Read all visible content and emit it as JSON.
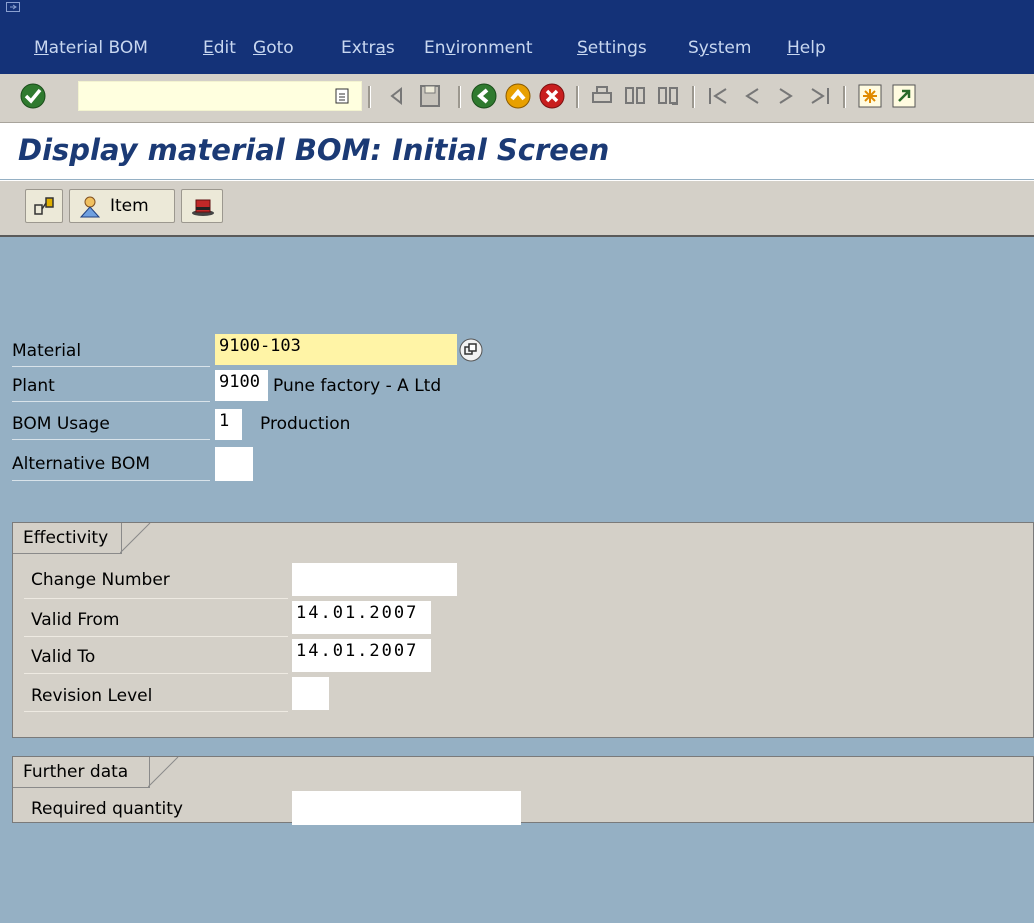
{
  "menu": {
    "items": [
      {
        "label": "Material BOM",
        "mnemonic_index": 0
      },
      {
        "label": "Edit",
        "mnemonic_index": 0
      },
      {
        "label": "Goto",
        "mnemonic_index": 0
      },
      {
        "label": "Extras",
        "mnemonic_index": 4
      },
      {
        "label": "Environment",
        "mnemonic_index": 2
      },
      {
        "label": "Settings",
        "mnemonic_index": 0
      },
      {
        "label": "System",
        "mnemonic_index": 1
      },
      {
        "label": "Help",
        "mnemonic_index": 0
      }
    ]
  },
  "toolbar": {
    "command_value": "",
    "icons": [
      "enter-icon",
      "back-arrow-icon",
      "save-icon",
      "back-icon",
      "exit-icon",
      "cancel-icon",
      "print-icon",
      "find-icon",
      "find-next-icon",
      "first-page-icon",
      "previous-page-icon",
      "next-page-icon",
      "last-page-icon",
      "new-session-icon",
      "shortcut-icon"
    ]
  },
  "page": {
    "title": "Display material BOM: Initial Screen"
  },
  "app_toolbar": {
    "item_label": "Item"
  },
  "form": {
    "material_label": "Material",
    "material_value": "9100-103",
    "plant_label": "Plant",
    "plant_value": "9100",
    "plant_desc": "Pune factory - A Ltd",
    "usage_label": "BOM Usage",
    "usage_value": "1",
    "usage_desc": "Production",
    "alt_bom_label": "Alternative BOM",
    "alt_bom_value": ""
  },
  "effectivity": {
    "title": "Effectivity",
    "change_number_label": "Change Number",
    "change_number_value": "",
    "valid_from_label": "Valid From",
    "valid_from_value": "14.01.2007",
    "valid_to_label": "Valid To",
    "valid_to_value": "14.01.2007",
    "revision_label": "Revision Level",
    "revision_value": ""
  },
  "further": {
    "title": "Further data",
    "required_qty_label": "Required quantity",
    "required_qty_value": ""
  },
  "colors": {
    "menubar": "#143278",
    "background": "#95b0c4",
    "title": "#1b3a75",
    "required_field": "#fff4a6"
  }
}
